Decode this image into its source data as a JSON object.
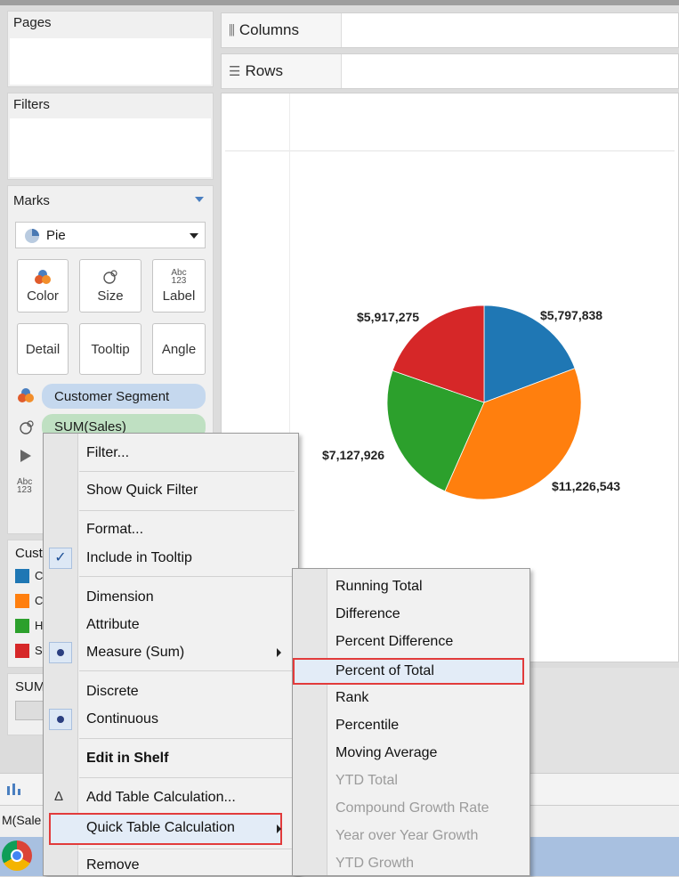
{
  "panels": {
    "pages": "Pages",
    "filters": "Filters",
    "marks": "Marks"
  },
  "shelves": {
    "columns": "Columns",
    "rows": "Rows"
  },
  "marks": {
    "type": "Pie",
    "buttons": {
      "color": "Color",
      "size": "Size",
      "label": "Label",
      "detail": "Detail",
      "tooltip": "Tooltip",
      "angle": "Angle"
    },
    "label_icon_text": "Abc\n123",
    "pills": {
      "customer_segment": "Customer Segment",
      "sum_sales": "SUM(Sales)"
    }
  },
  "legend": {
    "title_partial": "Cust",
    "colors": [
      "#1f77b4",
      "#ff7f0e",
      "#2ca02c",
      "#d62728"
    ],
    "partial_letters": [
      "C",
      "C",
      "H",
      "S"
    ]
  },
  "sum_card": "SUM",
  "bottom_partial": "M(Sale",
  "chart_data": {
    "type": "pie",
    "slices": [
      {
        "label": "$5,797,838",
        "value": 5797838,
        "color": "#1f77b4"
      },
      {
        "label": "$11,226,543",
        "value": 11226543,
        "color": "#ff7f0e"
      },
      {
        "label": "$7,127,926",
        "value": 7127926,
        "color": "#2ca02c"
      },
      {
        "label": "$5,917,275",
        "value": 5917275,
        "color": "#d62728"
      }
    ]
  },
  "context_menu": {
    "filter": "Filter...",
    "show_quick_filter": "Show Quick Filter",
    "format": "Format...",
    "include_in_tooltip": "Include in Tooltip",
    "dimension": "Dimension",
    "attribute": "Attribute",
    "measure": "Measure (Sum)",
    "discrete": "Discrete",
    "continuous": "Continuous",
    "edit_in_shelf": "Edit in Shelf",
    "add_table_calculation": "Add Table Calculation...",
    "quick_table_calculation": "Quick Table Calculation",
    "remove": "Remove"
  },
  "submenu": {
    "items": [
      {
        "label": "Running Total",
        "enabled": true
      },
      {
        "label": "Difference",
        "enabled": true
      },
      {
        "label": "Percent Difference",
        "enabled": true
      },
      {
        "label": "Percent of Total",
        "enabled": true,
        "highlighted": true
      },
      {
        "label": "Rank",
        "enabled": true
      },
      {
        "label": "Percentile",
        "enabled": true
      },
      {
        "label": "Moving Average",
        "enabled": true
      },
      {
        "label": "YTD Total",
        "enabled": false
      },
      {
        "label": "Compound Growth Rate",
        "enabled": false
      },
      {
        "label": "Year over Year Growth",
        "enabled": false
      },
      {
        "label": "YTD Growth",
        "enabled": false
      }
    ]
  }
}
